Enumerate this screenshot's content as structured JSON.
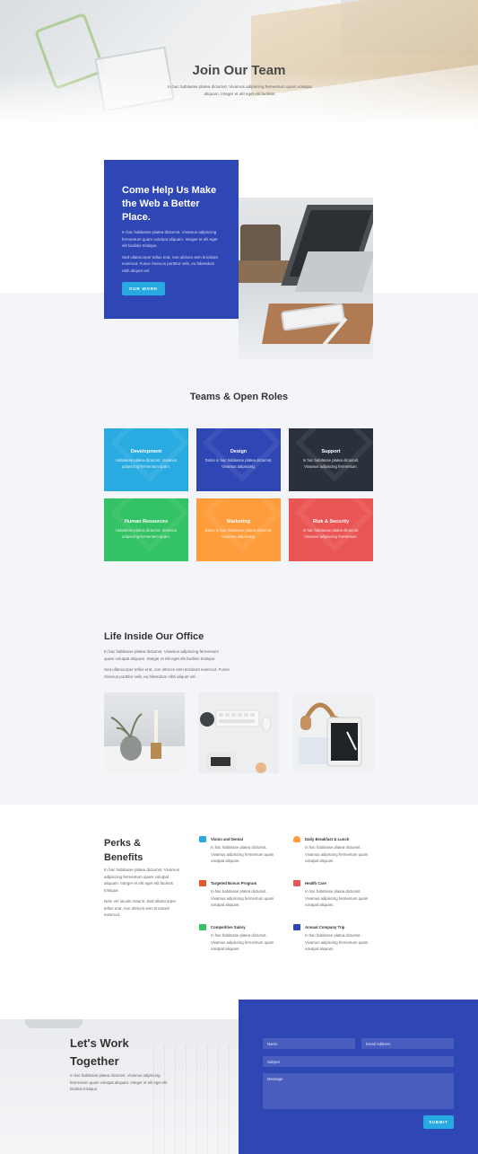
{
  "hero": {
    "title": "Join Our Team",
    "text": "In hac habitasse platea dictumst. Vivamus adipiscing fermentum quam volutpat aliquam. Integer et elit eget elit facilisis."
  },
  "help": {
    "title": "Come Help Us Make the Web a Better Place.",
    "p1": "In hac habitasse platea dictumst. Vivamus adipiscing fermentum quam volutpat aliquam. Integer et elit eget elit facilisis tristique.",
    "p2": "Sed ullamcorper tellus erat, non ultrices sem tincidunt euismod. Fusce rhoncus porttitor velit, eu bibendum nibh aliquet vel.",
    "button": "OUR WORK"
  },
  "teams": {
    "title": "Teams & Open Roles",
    "roles": [
      {
        "name": "Development",
        "text": "Habitasse platea dictumst. Vivamus adipiscing fermentum quam.",
        "color": "#29abe2"
      },
      {
        "name": "Design",
        "text": "Dotes in hac habitasse platea dictumst. Vivamus adipiscing.",
        "color": "#2f46b5"
      },
      {
        "name": "Support",
        "text": "In hac habitasse platea dictumst. Vivamus adipiscing fermentum.",
        "color": "#2b313c"
      },
      {
        "name": "Human Resources",
        "text": "Habitasse platea dictumst. Vivamus adipiscing fermentum quam.",
        "color": "#33c264"
      },
      {
        "name": "Marketing",
        "text": "Dotes in hac habitasse platea dictumst. Vivamus adipiscing.",
        "color": "#ff9d3c"
      },
      {
        "name": "Risk & Security",
        "text": "In hac habitasse platea dictumst. Vivamus adipiscing fermentum.",
        "color": "#ea5555"
      }
    ]
  },
  "office": {
    "title": "Life Inside Our Office",
    "p1": "In hac habitasse platea dictumst. Vivamus adipiscing fermentum quam volutpat aliquam. Integer et elit eget elit facilisis tristique.",
    "p2": "Sed ullamcorper tellus erat, non ultrices sem tincidunt euismod. Fusce rhoncus porttitor velit, eu bibendum nibh aliquet vel."
  },
  "perks": {
    "title": "Perks & Benefits",
    "p1": "In hac habitasse platea dictumst. Vivamus adipiscing fermentum quam volutpat aliquam. Integer et elit eget elit facilisis tristique.",
    "p2": "Nam vel iaculis mauris. Sed ullamcorper tellus erat, non ultrices sem tincidunt euismod.",
    "items": [
      {
        "name": "Vision and Dental",
        "text": "In hac habitasse platea dictumst. Vivamus adipiscing fermentum quam volutpat aliquam.",
        "icon": "vision-icon",
        "color": "#29abe2"
      },
      {
        "name": "Daily Breakfast & Lunch",
        "text": "In hac habitasse platea dictumst. Vivamus adipiscing fermentum quam volutpat aliquam.",
        "icon": "food-icon",
        "color": "#ff9d3c"
      },
      {
        "name": "Targeted Bonus Program",
        "text": "In hac habitasse platea dictumst. Vivamus adipiscing fermentum quam volutpat aliquam.",
        "icon": "bonus-icon",
        "color": "#e25a2c"
      },
      {
        "name": "Health Care",
        "text": "In hac habitasse platea dictumst. Vivamus adipiscing fermentum quam volutpat aliquam.",
        "icon": "health-icon",
        "color": "#ea5555"
      },
      {
        "name": "Competitive Salary",
        "text": "In hac habitasse platea dictumst. Vivamus adipiscing fermentum quam volutpat aliquam.",
        "icon": "salary-icon",
        "color": "#33c264"
      },
      {
        "name": "Annual Company Trip",
        "text": "In hac habitasse platea dictumst. Vivamus adipiscing fermentum quam volutpat aliquam.",
        "icon": "trip-icon",
        "color": "#2f46b5"
      }
    ]
  },
  "contact": {
    "title": "Let's Work Together",
    "text": "In hac habitasse platea dictumst. Vivamus adipiscing fermentum quam volutpat aliquam. Integer et elit eget elit facilisis tristique.",
    "name_placeholder": "Name",
    "email_placeholder": "Email Address",
    "subject_placeholder": "Subject",
    "message_placeholder": "Message",
    "submit": "SUBMIT"
  },
  "colors": {
    "accent": "#2f46b5",
    "button": "#27a9e1"
  }
}
